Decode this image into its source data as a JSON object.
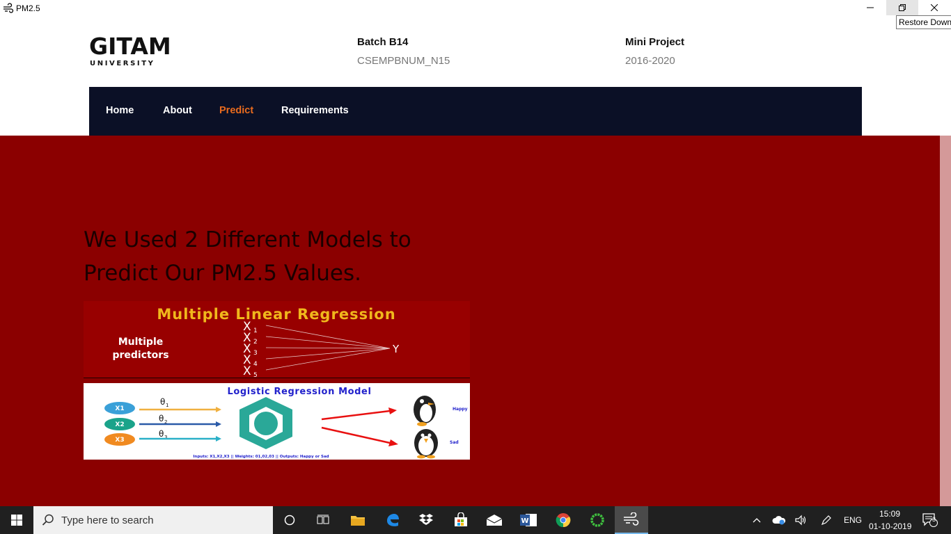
{
  "window": {
    "title": "PM2.5",
    "tooltip": "Restore Down"
  },
  "header": {
    "logo_main": "GITAM",
    "logo_sub": "UNIVERSITY",
    "batch_title": "Batch B14",
    "batch_sub": "CSEMPBNUM_N15",
    "project_title": "Mini Project",
    "project_sub": "2016-2020"
  },
  "nav": {
    "items": [
      {
        "label": "Home"
      },
      {
        "label": "About"
      },
      {
        "label": "Predict",
        "active": true
      },
      {
        "label": "Requirements"
      }
    ]
  },
  "main": {
    "heading_line1": "We Used 2 Different Models to",
    "heading_line2": "Predict Our PM2.5 Values.",
    "mlr": {
      "title": "Multiple Linear Regression",
      "left_line1": "Multiple",
      "left_line2": "predictors",
      "inputs": [
        "X",
        "X",
        "X",
        "X",
        "X"
      ],
      "subscripts": [
        "1",
        "2",
        "3",
        "4",
        "5"
      ],
      "output": "Y"
    },
    "logreg": {
      "title": "Logistic Regression Model",
      "inputs": [
        "X1",
        "X2",
        "X3"
      ],
      "weights": [
        "θ",
        "θ",
        "θ"
      ],
      "weight_subs": [
        "1",
        "2",
        "3"
      ],
      "out_happy": "Happy",
      "out_sad": "Sad",
      "caption": "Inputs: X1,X2,X3 || Weights: 01,02,03 || Outputs: Happy or Sad"
    }
  },
  "taskbar": {
    "search_placeholder": "Type here to search",
    "lang": "ENG",
    "time": "15:09",
    "date": "01-10-2019",
    "notifications": "3"
  },
  "colors": {
    "nav_bg": "#0b1026",
    "nav_active": "#e96b1e",
    "main_bg": "#8b0000",
    "mlr_title": "#f0b81c"
  }
}
